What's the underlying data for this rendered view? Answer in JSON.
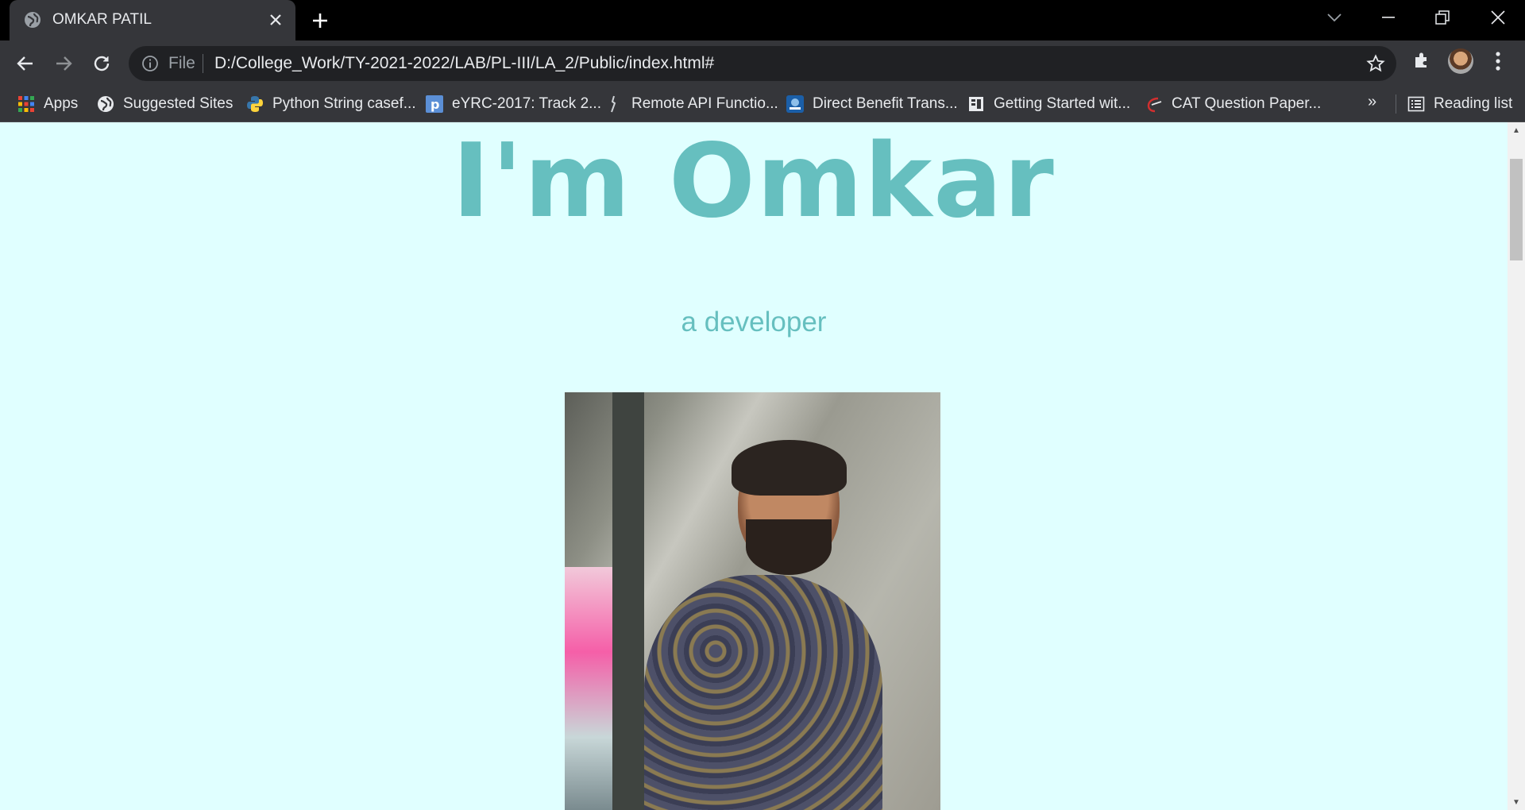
{
  "browser": {
    "tab": {
      "title": "OMKAR PATIL",
      "favicon": "globe-icon"
    },
    "address": {
      "scheme_label": "File",
      "url": "D:/College_Work/TY-2021-2022/LAB/PL-III/LA_2/Public/index.html#"
    },
    "bookmarks": [
      {
        "label": "Apps",
        "icon": "apps-grid-icon"
      },
      {
        "label": "Suggested Sites",
        "icon": "globe-icon"
      },
      {
        "label": "Python String casef...",
        "icon": "python-icon"
      },
      {
        "label": "eYRC-2017: Track 2...",
        "icon": "p-icon"
      },
      {
        "label": "Remote API Functio...",
        "icon": "figure-icon"
      },
      {
        "label": "Direct Benefit Trans...",
        "icon": "emblem-icon"
      },
      {
        "label": "Getting Started wit...",
        "icon": "book-icon"
      },
      {
        "label": "CAT Question Paper...",
        "icon": "logo-icon"
      }
    ],
    "overflow_label": "»",
    "reading_list": "Reading list"
  },
  "page": {
    "headline": "I'm Omkar",
    "subheading": "a developer",
    "photo_alt": "Portrait photo of Omkar"
  },
  "colors": {
    "page_bg": "#e0ffff",
    "accent_text": "#66bfbf",
    "chrome_dark": "#35363a",
    "tab_strip": "#000000"
  }
}
